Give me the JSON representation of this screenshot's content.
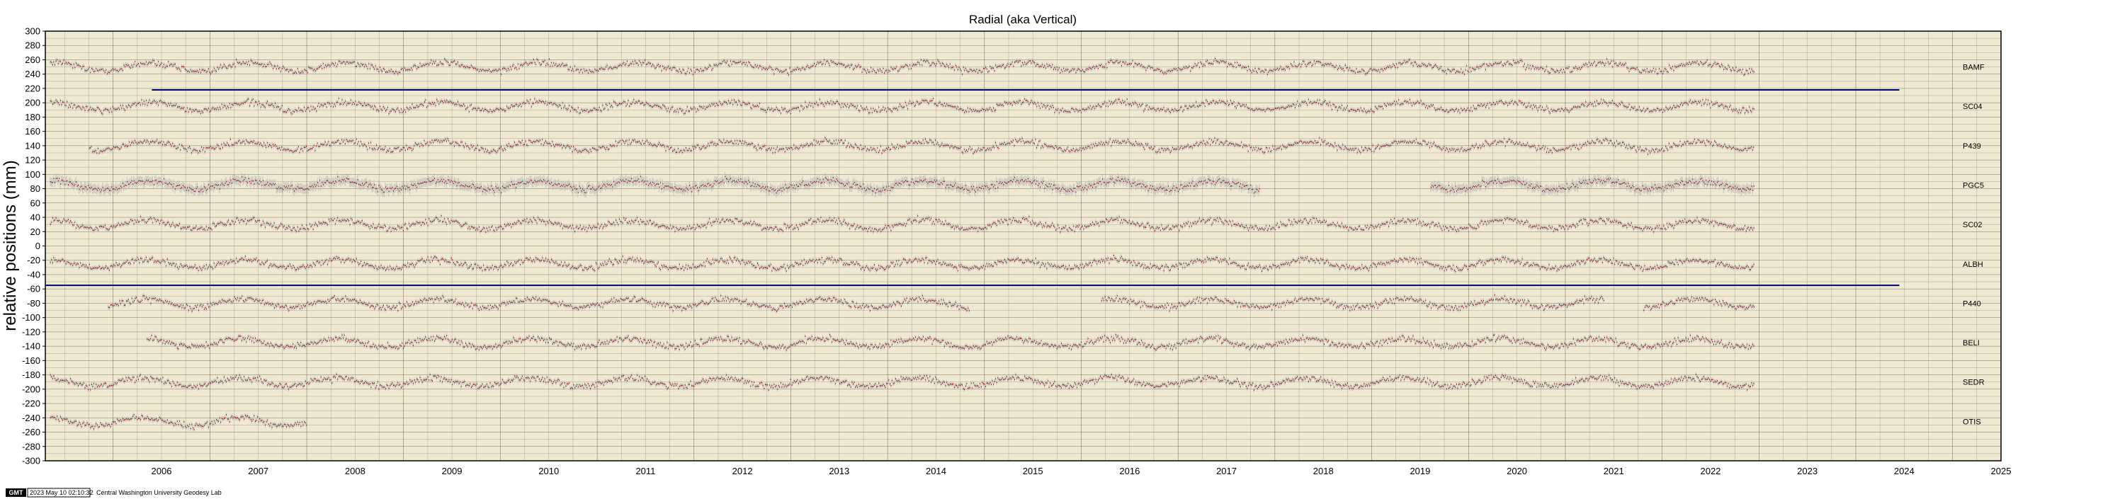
{
  "chart_data": {
    "type": "scatter",
    "title": "Radial (aka Vertical)",
    "ylabel": "relative positions (mm)",
    "xlabel": "",
    "xlim": [
      2005.3,
      2025.5
    ],
    "ylim": [
      -300,
      300
    ],
    "x_ticks": [
      "2006",
      "2007",
      "2008",
      "2009",
      "2010",
      "2011",
      "2012",
      "2013",
      "2014",
      "2015",
      "2016",
      "2017",
      "2018",
      "2019",
      "2020",
      "2021",
      "2022",
      "2023",
      "2024",
      "2025"
    ],
    "y_ticks": [
      "300",
      "280",
      "260",
      "240",
      "220",
      "200",
      "180",
      "160",
      "140",
      "120",
      "100",
      "80",
      "60",
      "40",
      "20",
      "0",
      "-20",
      "-40",
      "-60",
      "-80",
      "-100",
      "-120",
      "-140",
      "-160",
      "-180",
      "-200",
      "-220",
      "-240",
      "-260",
      "-280",
      "-300"
    ],
    "grid": true,
    "background": "#efe9d2",
    "marker_color": "#7a0000",
    "error_color": "#b8b8b8",
    "reference_line_color": "#00006e",
    "series": [
      {
        "name": "BAMF",
        "offset": 250,
        "start": 2005.35,
        "end": 2022.95,
        "gaps": []
      },
      {
        "name": "SC04",
        "offset": 195,
        "start": 2005.35,
        "end": 2022.95,
        "gaps": []
      },
      {
        "name": "P439",
        "offset": 140,
        "start": 2005.75,
        "end": 2022.95,
        "gaps": []
      },
      {
        "name": "PGC5",
        "offset": 85,
        "start": 2005.35,
        "end": 2022.95,
        "gaps": [
          [
            2017.85,
            2019.6
          ]
        ]
      },
      {
        "name": "SC02",
        "offset": 30,
        "start": 2005.35,
        "end": 2022.95,
        "gaps": []
      },
      {
        "name": "ALBH",
        "offset": -25,
        "start": 2005.35,
        "end": 2022.95,
        "gaps": []
      },
      {
        "name": "P440",
        "offset": -80,
        "start": 2005.95,
        "end": 2022.95,
        "gaps": [
          [
            2014.85,
            2016.2
          ],
          [
            2021.4,
            2021.8
          ]
        ]
      },
      {
        "name": "BELI",
        "offset": -135,
        "start": 2006.35,
        "end": 2022.95,
        "gaps": []
      },
      {
        "name": "SEDR",
        "offset": -190,
        "start": 2005.35,
        "end": 2022.95,
        "gaps": []
      },
      {
        "name": "OTIS",
        "offset": -245,
        "start": 2005.35,
        "end": 2008.0,
        "gaps": []
      }
    ],
    "reference_lines": [
      {
        "y": 218,
        "x_start": 2006.4,
        "x_end": 2024.45
      },
      {
        "y": -55,
        "x_start": 2005.3,
        "x_end": 2024.45
      }
    ]
  },
  "footer": {
    "badge": "GMT",
    "timestamp": "2023 May 10 02:10:32",
    "credit": "Central Washington University Geodesy Lab"
  }
}
